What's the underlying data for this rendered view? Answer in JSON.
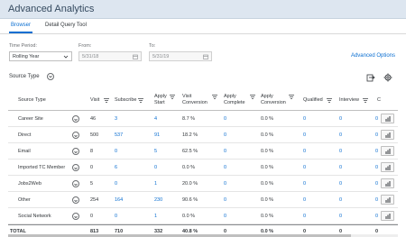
{
  "app": {
    "title": "Advanced Analytics"
  },
  "tabs": [
    {
      "label": "Browser",
      "active": true
    },
    {
      "label": "Detail Query Tool",
      "active": false
    }
  ],
  "filters": {
    "time_period_label": "Time Period:",
    "time_period_value": "Rolling Year",
    "from_label": "From:",
    "from_value": "5/31/18",
    "to_label": "To:",
    "to_value": "5/31/19",
    "advanced_options": "Advanced Options"
  },
  "source_type_label": "Source Type",
  "table": {
    "headers": {
      "source_type": "Source Type",
      "visit": "Visit",
      "subscribe": "Subscribe",
      "apply_start_1": "Apply",
      "apply_start_2": "Start",
      "visit_conv_1": "Visit",
      "visit_conv_2": "Conversion",
      "apply_complete_1": "Apply",
      "apply_complete_2": "Complete",
      "apply_conv_1": "Apply",
      "apply_conv_2": "Conversion",
      "qualified": "Qualified",
      "interview": "Interview",
      "c": "C"
    },
    "rows": [
      {
        "source": "Career Site",
        "visit": "46",
        "subscribe": "3",
        "apply_start": "4",
        "visit_conv": "8.7 %",
        "apply_complete": "0",
        "apply_conv": "0.0 %",
        "qualified": "0",
        "interview": "0",
        "c": "0"
      },
      {
        "source": "Direct",
        "visit": "500",
        "subscribe": "537",
        "apply_start": "91",
        "visit_conv": "18.2 %",
        "apply_complete": "0",
        "apply_conv": "0.0 %",
        "qualified": "0",
        "interview": "0",
        "c": "0"
      },
      {
        "source": "Email",
        "visit": "8",
        "subscribe": "0",
        "apply_start": "5",
        "visit_conv": "62.5 %",
        "apply_complete": "0",
        "apply_conv": "0.0 %",
        "qualified": "0",
        "interview": "0",
        "c": "0"
      },
      {
        "source": "Imported TC Member",
        "visit": "0",
        "subscribe": "6",
        "apply_start": "0",
        "visit_conv": "0.0 %",
        "apply_complete": "0",
        "apply_conv": "0.0 %",
        "qualified": "0",
        "interview": "0",
        "c": "0"
      },
      {
        "source": "Jobs2Web",
        "visit": "5",
        "subscribe": "0",
        "apply_start": "1",
        "visit_conv": "20.0 %",
        "apply_complete": "0",
        "apply_conv": "0.0 %",
        "qualified": "0",
        "interview": "0",
        "c": "0"
      },
      {
        "source": "Other",
        "visit": "254",
        "subscribe": "164",
        "apply_start": "230",
        "visit_conv": "90.6 %",
        "apply_complete": "0",
        "apply_conv": "0.0 %",
        "qualified": "0",
        "interview": "0",
        "c": "0"
      },
      {
        "source": "Social Network",
        "visit": "0",
        "subscribe": "0",
        "apply_start": "1",
        "visit_conv": "0.0 %",
        "apply_complete": "0",
        "apply_conv": "0.0 %",
        "qualified": "0",
        "interview": "0",
        "c": "0"
      }
    ],
    "total": {
      "source": "TOTAL",
      "visit": "813",
      "subscribe": "710",
      "apply_start": "332",
      "visit_conv": "40.8 %",
      "apply_complete": "0",
      "apply_conv": "0.0 %",
      "qualified": "0",
      "interview": "0",
      "c": "0"
    }
  },
  "colors": {
    "accent": "#0a6ed1",
    "header_bg": "#dde6f0",
    "text": "#32363a"
  },
  "icons": [
    "chevron-down-icon",
    "calendar-icon",
    "filter-icon",
    "export-icon",
    "settings-icon",
    "bar-chart-icon"
  ]
}
